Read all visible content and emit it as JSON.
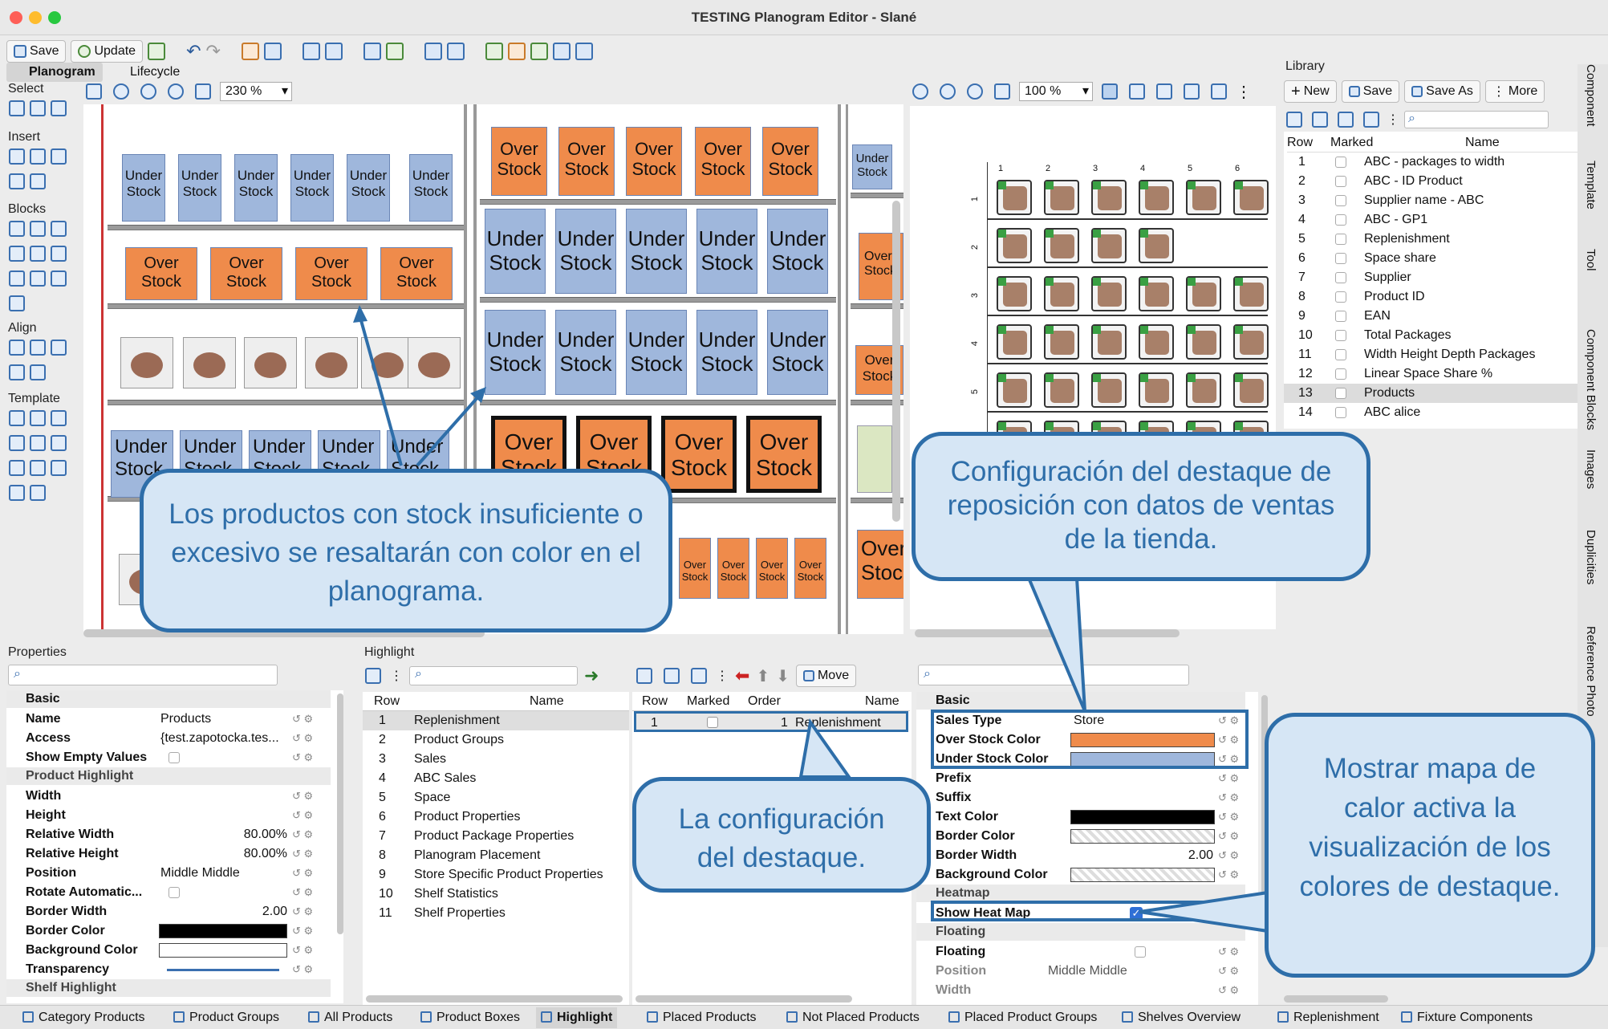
{
  "window": {
    "title": "TESTING Planogram Editor - Slané"
  },
  "toolbar": {
    "save": "Save",
    "update": "Update"
  },
  "tabs": {
    "planogram": "Planogram",
    "lifecycle": "Lifecycle"
  },
  "left_tools": {
    "select": "Select",
    "insert": "Insert",
    "blocks": "Blocks",
    "align": "Align",
    "template": "Template"
  },
  "zoom_left": "230 %",
  "zoom_right": "100 %",
  "labels": {
    "under": "Under",
    "stock": "Stock",
    "over": "Over",
    "under_stock": "Under Stock",
    "over_stock": "Over Stock"
  },
  "library": {
    "title": "Library",
    "new": "New",
    "save": "Save",
    "save_as": "Save As",
    "more": "More",
    "headers": [
      "Row",
      "Marked",
      "Name"
    ],
    "rows": [
      [
        "1",
        "ABC - packages to width"
      ],
      [
        "2",
        "ABC - ID Product"
      ],
      [
        "3",
        "Supplier name - ABC"
      ],
      [
        "4",
        "ABC - GP1"
      ],
      [
        "5",
        "Replenishment"
      ],
      [
        "6",
        "Space share"
      ],
      [
        "7",
        "Supplier"
      ],
      [
        "8",
        "Product ID"
      ],
      [
        "9",
        "EAN"
      ],
      [
        "10",
        "Total Packages"
      ],
      [
        "11",
        "Width Height Depth Packages"
      ],
      [
        "12",
        "Linear Space Share %"
      ],
      [
        "13",
        "Products"
      ],
      [
        "14",
        "ABC alice"
      ]
    ]
  },
  "side_tabs": [
    "Component",
    "Template",
    "Tool",
    "Component Blocks",
    "Images",
    "Duplicities",
    "Reference Photo"
  ],
  "properties": {
    "title": "Properties",
    "basic": "Basic",
    "rows": [
      {
        "n": "Name",
        "v": "Products"
      },
      {
        "n": "Access",
        "v": "{test.zapotocka.tes..."
      },
      {
        "n": "Show Empty Values",
        "v": ""
      }
    ],
    "product_highlight": "Product Highlight",
    "rows2": [
      {
        "n": "Width",
        "v": ""
      },
      {
        "n": "Height",
        "v": ""
      },
      {
        "n": "Relative Width",
        "v": "80.00%"
      },
      {
        "n": "Relative Height",
        "v": "80.00%"
      },
      {
        "n": "Position",
        "v": "Middle Middle"
      },
      {
        "n": "Rotate Automatic...",
        "v": ""
      },
      {
        "n": "Border Width",
        "v": "2.00"
      },
      {
        "n": "Border Color",
        "v": ""
      },
      {
        "n": "Background Color",
        "v": ""
      },
      {
        "n": "Transparency",
        "v": ""
      }
    ],
    "shelf_highlight": "Shelf Highlight"
  },
  "highlight": {
    "title": "Highlight",
    "headers": [
      "Row",
      "Name"
    ],
    "rows": [
      [
        "1",
        "Replenishment"
      ],
      [
        "2",
        "Product Groups"
      ],
      [
        "3",
        "Sales"
      ],
      [
        "4",
        "ABC Sales"
      ],
      [
        "5",
        "Space"
      ],
      [
        "6",
        "Product Properties"
      ],
      [
        "7",
        "Product Package Properties"
      ],
      [
        "8",
        "Planogram Placement"
      ],
      [
        "9",
        "Store Specific Product Properties"
      ],
      [
        "10",
        "Shelf Statistics"
      ],
      [
        "11",
        "Shelf Properties"
      ]
    ]
  },
  "assigned": {
    "headers": [
      "Row",
      "Marked",
      "Order",
      "Name"
    ],
    "move": "Move",
    "row": [
      "1",
      "",
      "1",
      "Replenishment"
    ]
  },
  "hl_props": {
    "basic": "Basic",
    "rows": [
      {
        "n": "Sales Type",
        "v": "Store"
      },
      {
        "n": "Over Stock Color",
        "v": ""
      },
      {
        "n": "Under Stock Color",
        "v": ""
      },
      {
        "n": "Prefix",
        "v": ""
      },
      {
        "n": "Suffix",
        "v": ""
      },
      {
        "n": "Text Color",
        "v": ""
      },
      {
        "n": "Border Color",
        "v": ""
      },
      {
        "n": "Border Width",
        "v": "2.00"
      },
      {
        "n": "Background Color",
        "v": ""
      }
    ],
    "heatmap": "Heatmap",
    "show_heat_map": "Show Heat Map",
    "floating": "Floating",
    "rows3": [
      {
        "n": "Floating",
        "v": ""
      },
      {
        "n": "Position",
        "v": "Middle Middle"
      },
      {
        "n": "Width",
        "v": ""
      }
    ]
  },
  "bottom_tabs": [
    "Category Products",
    "Product Groups",
    "All Products",
    "Product Boxes",
    "Highlight",
    "Placed Products",
    "Not Placed Products",
    "Placed Product Groups",
    "Shelves Overview",
    "Replenishment",
    "Fixture Components"
  ],
  "callouts": {
    "c1": "Los productos con stock insuficiente o excesivo se resaltarán con color en el planograma.",
    "c2": "Configuración del destaque de reposición con datos de ventas de la tienda.",
    "c3": "La configuración del destaque.",
    "c4": "Mostrar mapa de calor activa la visualización de los colores de destaque."
  },
  "minimap_cols": [
    "1",
    "2",
    "3",
    "4",
    "5",
    "6"
  ],
  "minimap_rows": [
    "1",
    "2",
    "3",
    "4",
    "5"
  ],
  "colors": {
    "over": "#ef8b4b",
    "under": "#9fb7dc",
    "callout_border": "#2e6ea9",
    "callout_bg": "#d6e6f5"
  }
}
